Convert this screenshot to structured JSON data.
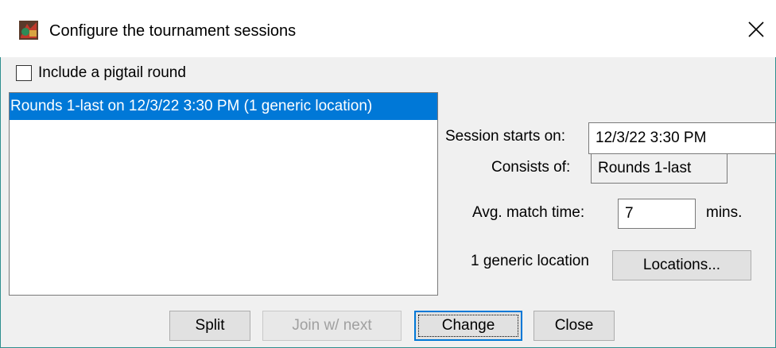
{
  "window": {
    "title": "Configure the tournament sessions",
    "icon": "tournament-app-icon",
    "close_icon": "close-icon"
  },
  "pigtail": {
    "label": "Include a pigtail round",
    "checked": false
  },
  "sessions": [
    {
      "label": "Rounds 1-last on 12/3/22 3:30 PM (1 generic location)",
      "selected": true
    }
  ],
  "details": {
    "starts_label": "Session starts on:",
    "starts_value": "12/3/22 3:30 PM",
    "consists_label": "Consists of:",
    "consists_value": "Rounds 1-last",
    "avg_label": "Avg. match time:",
    "avg_value": "7",
    "avg_unit": "mins.",
    "location_text": "1 generic location",
    "locations_button": "Locations..."
  },
  "buttons": {
    "split": "Split",
    "join": "Join w/ next",
    "change": "Change",
    "close": "Close"
  },
  "colors": {
    "selection": "#0078d7",
    "accent_border": "#2f8f8f"
  }
}
